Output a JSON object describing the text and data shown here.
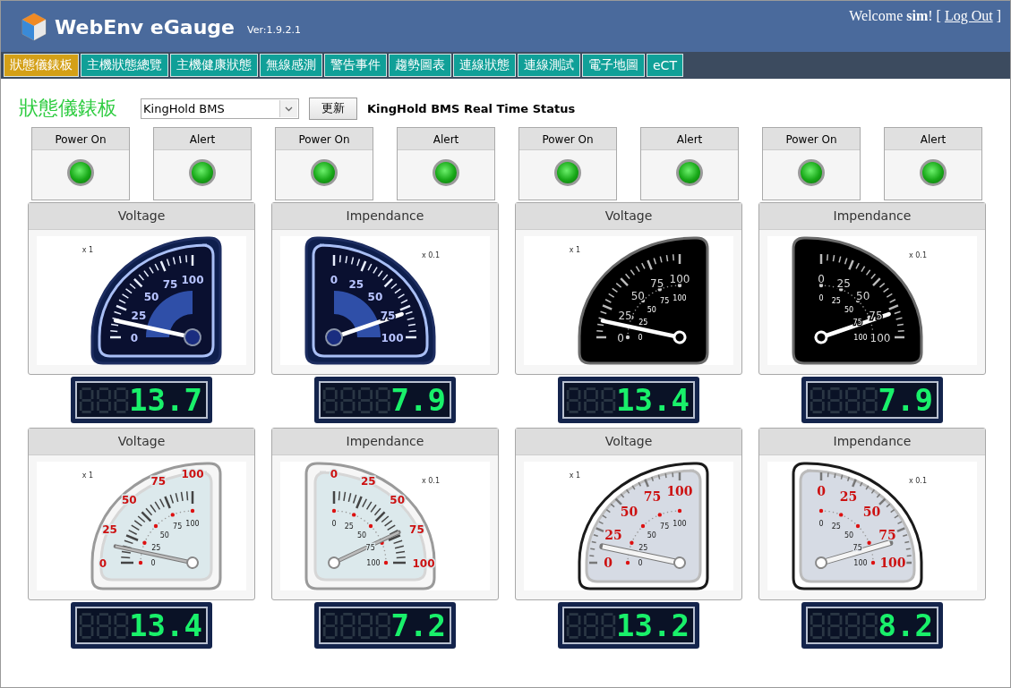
{
  "header": {
    "title": "WebEnv eGauge",
    "version": "Ver:1.9.2.1",
    "greeting": "Welcome **sim**!",
    "open": "[",
    "link": "Log Out",
    "close": "]"
  },
  "nav": [
    {
      "label": "狀態儀錶板",
      "selected": true
    },
    {
      "label": "主機狀態總覽",
      "selected": false
    },
    {
      "label": "主機健康狀態",
      "selected": false
    },
    {
      "label": "無線感測",
      "selected": false
    },
    {
      "label": "警告事件",
      "selected": false
    },
    {
      "label": "趨勢圖表",
      "selected": false
    },
    {
      "label": "連線狀態",
      "selected": false
    },
    {
      "label": "連線測試",
      "selected": false
    },
    {
      "label": "電子地圖",
      "selected": false
    },
    {
      "label": "eCT",
      "selected": false
    }
  ],
  "toolbar": {
    "page_title": "狀態儀錶板",
    "device": "KingHold BMS",
    "button": "更新",
    "status_title": "KingHold BMS Real Time Status"
  },
  "indicators": [
    {
      "label": "Power On",
      "on": true
    },
    {
      "label": "Alert",
      "on": true
    },
    {
      "label": "Power On",
      "on": true
    },
    {
      "label": "Alert",
      "on": true
    },
    {
      "label": "Power On",
      "on": true
    },
    {
      "label": "Alert",
      "on": true
    },
    {
      "label": "Power On",
      "on": true
    },
    {
      "label": "Alert",
      "on": true
    }
  ],
  "gauges": [
    {
      "title": "Voltage",
      "kind": "navy",
      "multiplier": "x 1",
      "scale": [
        "0",
        "25",
        "50",
        "75",
        "100"
      ],
      "reading": "13.7"
    },
    {
      "title": "Impendance",
      "kind": "navy",
      "multiplier": "x 0.1",
      "scale": [
        "0",
        "25",
        "50",
        "75",
        "100"
      ],
      "reading": "7.9"
    },
    {
      "title": "Voltage",
      "kind": "black",
      "multiplier": "x 1",
      "scale": [
        "0",
        "25",
        "50",
        "75",
        "100"
      ],
      "inner_scale": [
        "0",
        "25",
        "50",
        "75",
        "100"
      ],
      "reading": "13.4"
    },
    {
      "title": "Impendance",
      "kind": "black",
      "multiplier": "x 0.1",
      "scale": [
        "0",
        "25",
        "50",
        "75",
        "100"
      ],
      "inner_scale": [
        "0",
        "25",
        "50",
        "75",
        "100"
      ],
      "reading": "7.9"
    },
    {
      "title": "Voltage",
      "kind": "silver",
      "multiplier": "x 1",
      "scale": [
        "0",
        "25",
        "50",
        "75",
        "100"
      ],
      "inner_scale": [
        "0",
        "25",
        "50",
        "75",
        "100"
      ],
      "reading": "13.4"
    },
    {
      "title": "Impendance",
      "kind": "silver",
      "multiplier": "x 0.1",
      "scale": [
        "0",
        "25",
        "50",
        "75",
        "100"
      ],
      "inner_scale": [
        "0",
        "25",
        "50",
        "75",
        "100"
      ],
      "reading": "7.2"
    },
    {
      "title": "Voltage",
      "kind": "chrome",
      "multiplier": "x 1",
      "scale": [
        "0",
        "25",
        "50",
        "75",
        "100"
      ],
      "inner_scale": [
        "0",
        "25",
        "50",
        "75",
        "100"
      ],
      "reading": "13.2"
    },
    {
      "title": "Impendance",
      "kind": "chrome",
      "multiplier": "x 0.1",
      "scale": [
        "0",
        "25",
        "50",
        "75",
        "100"
      ],
      "inner_scale": [
        "0",
        "25",
        "50",
        "75",
        "100"
      ],
      "reading": "8.2"
    }
  ]
}
